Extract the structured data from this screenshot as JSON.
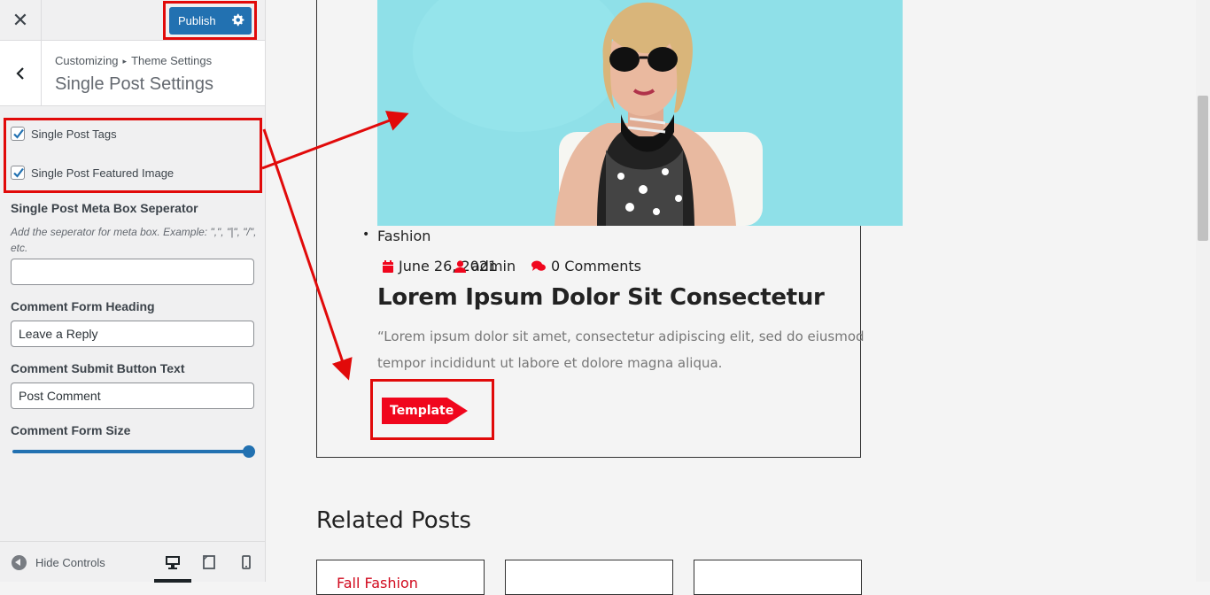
{
  "topbar": {
    "close_glyph": "✕",
    "publish_label": "Publish"
  },
  "section": {
    "breadcrumb_root": "Customizing",
    "breadcrumb_sep": "▸",
    "breadcrumb_parent": "Theme Settings",
    "title": "Single Post Settings"
  },
  "controls": {
    "checkboxes": [
      {
        "label": "Single Post Tags",
        "checked": true
      },
      {
        "label": "Single Post Featured Image",
        "checked": true
      }
    ],
    "meta_separator": {
      "label": "Single Post Meta Box Seperator",
      "description": "Add the seperator for meta box. Example: \",\", \"|\", \"/\", etc.",
      "value": ""
    },
    "comment_heading": {
      "label": "Comment Form Heading",
      "value": "Leave a Reply"
    },
    "comment_submit": {
      "label": "Comment Submit Button Text",
      "value": "Post Comment"
    },
    "comment_size": {
      "label": "Comment Form Size",
      "value_fraction": 1.0
    }
  },
  "footer": {
    "hide_controls": "Hide Controls",
    "active_device": "desktop"
  },
  "preview": {
    "category": "Fashion",
    "date": "June 26, 2021",
    "author": "admin",
    "comments": "0 Comments",
    "post_title": "Lorem Ipsum Dolor Sit Consectetur",
    "excerpt": "“Lorem ipsum dolor sit amet, consectetur adipiscing elit, sed do eiusmod tempor incididunt ut labore et dolore magna aliqua.",
    "tag": "Template",
    "related_heading": "Related Posts",
    "related_first_title": "Fall Fashion"
  },
  "colors": {
    "accent": "#2271b1",
    "highlight": "#e10a0a",
    "brand_red": "#f0061d",
    "image_bg": "#8fe0e8"
  }
}
